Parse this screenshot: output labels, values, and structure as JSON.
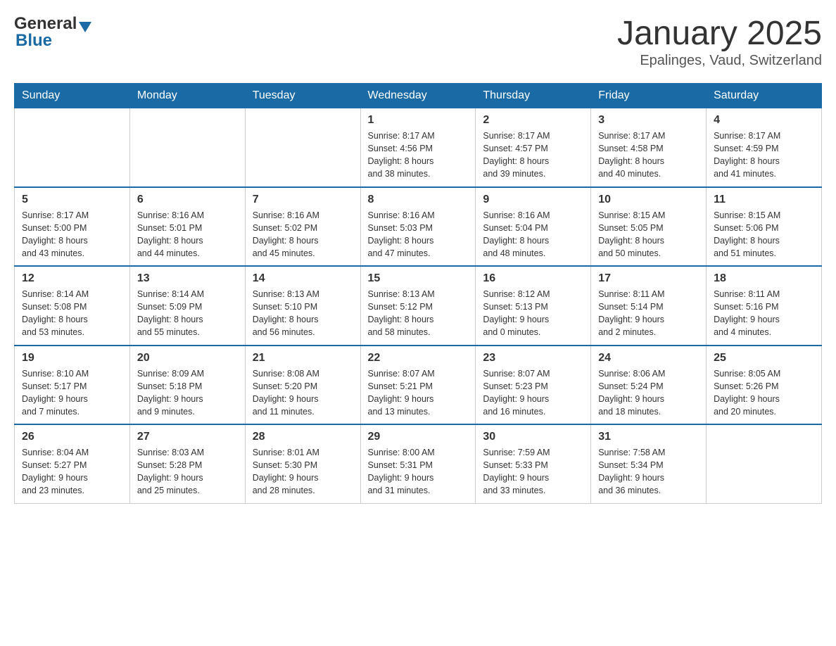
{
  "header": {
    "logo": {
      "general": "General",
      "blue": "Blue",
      "triangle": "▼"
    },
    "title": "January 2025",
    "location": "Epalinges, Vaud, Switzerland"
  },
  "calendar": {
    "days_of_week": [
      "Sunday",
      "Monday",
      "Tuesday",
      "Wednesday",
      "Thursday",
      "Friday",
      "Saturday"
    ],
    "weeks": [
      {
        "days": [
          {
            "number": "",
            "info": ""
          },
          {
            "number": "",
            "info": ""
          },
          {
            "number": "",
            "info": ""
          },
          {
            "number": "1",
            "info": "Sunrise: 8:17 AM\nSunset: 4:56 PM\nDaylight: 8 hours\nand 38 minutes."
          },
          {
            "number": "2",
            "info": "Sunrise: 8:17 AM\nSunset: 4:57 PM\nDaylight: 8 hours\nand 39 minutes."
          },
          {
            "number": "3",
            "info": "Sunrise: 8:17 AM\nSunset: 4:58 PM\nDaylight: 8 hours\nand 40 minutes."
          },
          {
            "number": "4",
            "info": "Sunrise: 8:17 AM\nSunset: 4:59 PM\nDaylight: 8 hours\nand 41 minutes."
          }
        ]
      },
      {
        "days": [
          {
            "number": "5",
            "info": "Sunrise: 8:17 AM\nSunset: 5:00 PM\nDaylight: 8 hours\nand 43 minutes."
          },
          {
            "number": "6",
            "info": "Sunrise: 8:16 AM\nSunset: 5:01 PM\nDaylight: 8 hours\nand 44 minutes."
          },
          {
            "number": "7",
            "info": "Sunrise: 8:16 AM\nSunset: 5:02 PM\nDaylight: 8 hours\nand 45 minutes."
          },
          {
            "number": "8",
            "info": "Sunrise: 8:16 AM\nSunset: 5:03 PM\nDaylight: 8 hours\nand 47 minutes."
          },
          {
            "number": "9",
            "info": "Sunrise: 8:16 AM\nSunset: 5:04 PM\nDaylight: 8 hours\nand 48 minutes."
          },
          {
            "number": "10",
            "info": "Sunrise: 8:15 AM\nSunset: 5:05 PM\nDaylight: 8 hours\nand 50 minutes."
          },
          {
            "number": "11",
            "info": "Sunrise: 8:15 AM\nSunset: 5:06 PM\nDaylight: 8 hours\nand 51 minutes."
          }
        ]
      },
      {
        "days": [
          {
            "number": "12",
            "info": "Sunrise: 8:14 AM\nSunset: 5:08 PM\nDaylight: 8 hours\nand 53 minutes."
          },
          {
            "number": "13",
            "info": "Sunrise: 8:14 AM\nSunset: 5:09 PM\nDaylight: 8 hours\nand 55 minutes."
          },
          {
            "number": "14",
            "info": "Sunrise: 8:13 AM\nSunset: 5:10 PM\nDaylight: 8 hours\nand 56 minutes."
          },
          {
            "number": "15",
            "info": "Sunrise: 8:13 AM\nSunset: 5:12 PM\nDaylight: 8 hours\nand 58 minutes."
          },
          {
            "number": "16",
            "info": "Sunrise: 8:12 AM\nSunset: 5:13 PM\nDaylight: 9 hours\nand 0 minutes."
          },
          {
            "number": "17",
            "info": "Sunrise: 8:11 AM\nSunset: 5:14 PM\nDaylight: 9 hours\nand 2 minutes."
          },
          {
            "number": "18",
            "info": "Sunrise: 8:11 AM\nSunset: 5:16 PM\nDaylight: 9 hours\nand 4 minutes."
          }
        ]
      },
      {
        "days": [
          {
            "number": "19",
            "info": "Sunrise: 8:10 AM\nSunset: 5:17 PM\nDaylight: 9 hours\nand 7 minutes."
          },
          {
            "number": "20",
            "info": "Sunrise: 8:09 AM\nSunset: 5:18 PM\nDaylight: 9 hours\nand 9 minutes."
          },
          {
            "number": "21",
            "info": "Sunrise: 8:08 AM\nSunset: 5:20 PM\nDaylight: 9 hours\nand 11 minutes."
          },
          {
            "number": "22",
            "info": "Sunrise: 8:07 AM\nSunset: 5:21 PM\nDaylight: 9 hours\nand 13 minutes."
          },
          {
            "number": "23",
            "info": "Sunrise: 8:07 AM\nSunset: 5:23 PM\nDaylight: 9 hours\nand 16 minutes."
          },
          {
            "number": "24",
            "info": "Sunrise: 8:06 AM\nSunset: 5:24 PM\nDaylight: 9 hours\nand 18 minutes."
          },
          {
            "number": "25",
            "info": "Sunrise: 8:05 AM\nSunset: 5:26 PM\nDaylight: 9 hours\nand 20 minutes."
          }
        ]
      },
      {
        "days": [
          {
            "number": "26",
            "info": "Sunrise: 8:04 AM\nSunset: 5:27 PM\nDaylight: 9 hours\nand 23 minutes."
          },
          {
            "number": "27",
            "info": "Sunrise: 8:03 AM\nSunset: 5:28 PM\nDaylight: 9 hours\nand 25 minutes."
          },
          {
            "number": "28",
            "info": "Sunrise: 8:01 AM\nSunset: 5:30 PM\nDaylight: 9 hours\nand 28 minutes."
          },
          {
            "number": "29",
            "info": "Sunrise: 8:00 AM\nSunset: 5:31 PM\nDaylight: 9 hours\nand 31 minutes."
          },
          {
            "number": "30",
            "info": "Sunrise: 7:59 AM\nSunset: 5:33 PM\nDaylight: 9 hours\nand 33 minutes."
          },
          {
            "number": "31",
            "info": "Sunrise: 7:58 AM\nSunset: 5:34 PM\nDaylight: 9 hours\nand 36 minutes."
          },
          {
            "number": "",
            "info": ""
          }
        ]
      }
    ]
  }
}
